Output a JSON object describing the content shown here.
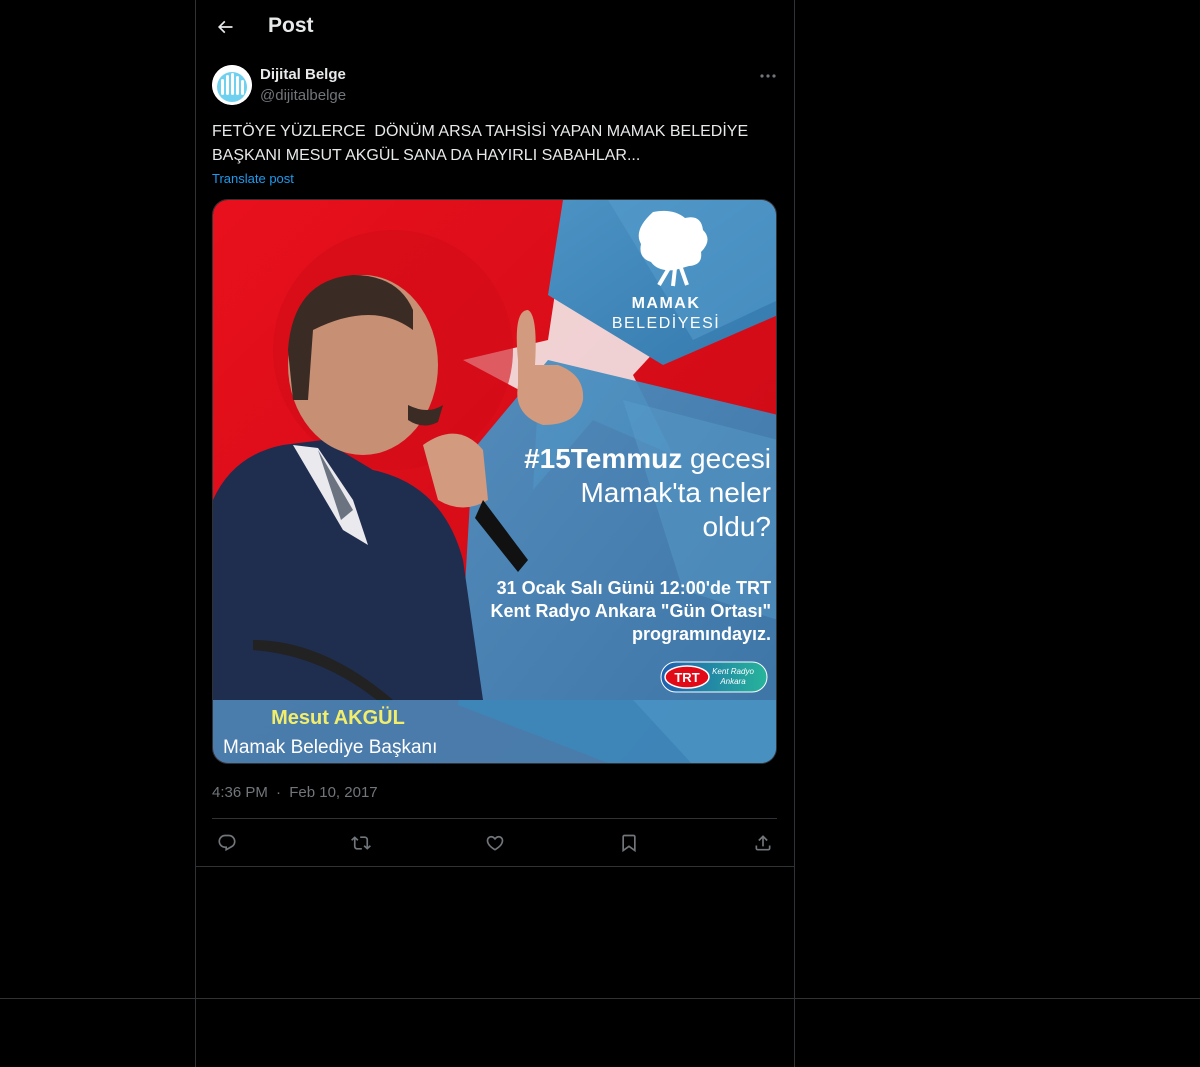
{
  "header": {
    "title": "Post"
  },
  "author": {
    "name": "Dijital Belge",
    "handle": "@dijitalbelge"
  },
  "post": {
    "text": "FETÖYE YÜZLERCE  DÖNÜM ARSA TAHSİSİ YAPAN MAMAK BELEDİYE\nBAŞKANI MESUT AKGÜL SANA DA HAYIRLI SABAHLAR...",
    "translate_label": "Translate post",
    "time": "4:36 PM",
    "separator": "·",
    "date": "Feb 10, 2017"
  },
  "media": {
    "logo_line1": "MAMAK",
    "logo_line2": "BELEDİYESİ",
    "hashtag": "#15Temmuz",
    "headline_rest": " gecesi",
    "headline_line2": "Mamak'ta neler",
    "headline_line3": "oldu?",
    "info_line1": "31 Ocak Salı Günü 12:00'de TRT",
    "info_line2": "Kent Radyo Ankara \"Gün Ortası\"",
    "info_line3": "programındayız.",
    "trt_label": "TRT",
    "trt_sub1": "Kent Radyo",
    "trt_sub2": "Ankara",
    "person_name": "Mesut AKGÜL",
    "person_title": "Mamak Belediye Başkanı"
  },
  "actions": [
    "reply-icon",
    "repost-icon",
    "like-icon",
    "bookmark-icon",
    "share-icon"
  ],
  "colors": {
    "background": "#000000",
    "border": "#2f3336",
    "text_primary": "#e7e9ea",
    "text_secondary": "#71767b",
    "link": "#1d9bf0",
    "flag_red": "#e30a17",
    "panel_blue": "#3d86b8",
    "name_yellow": "#f2ee6b"
  }
}
